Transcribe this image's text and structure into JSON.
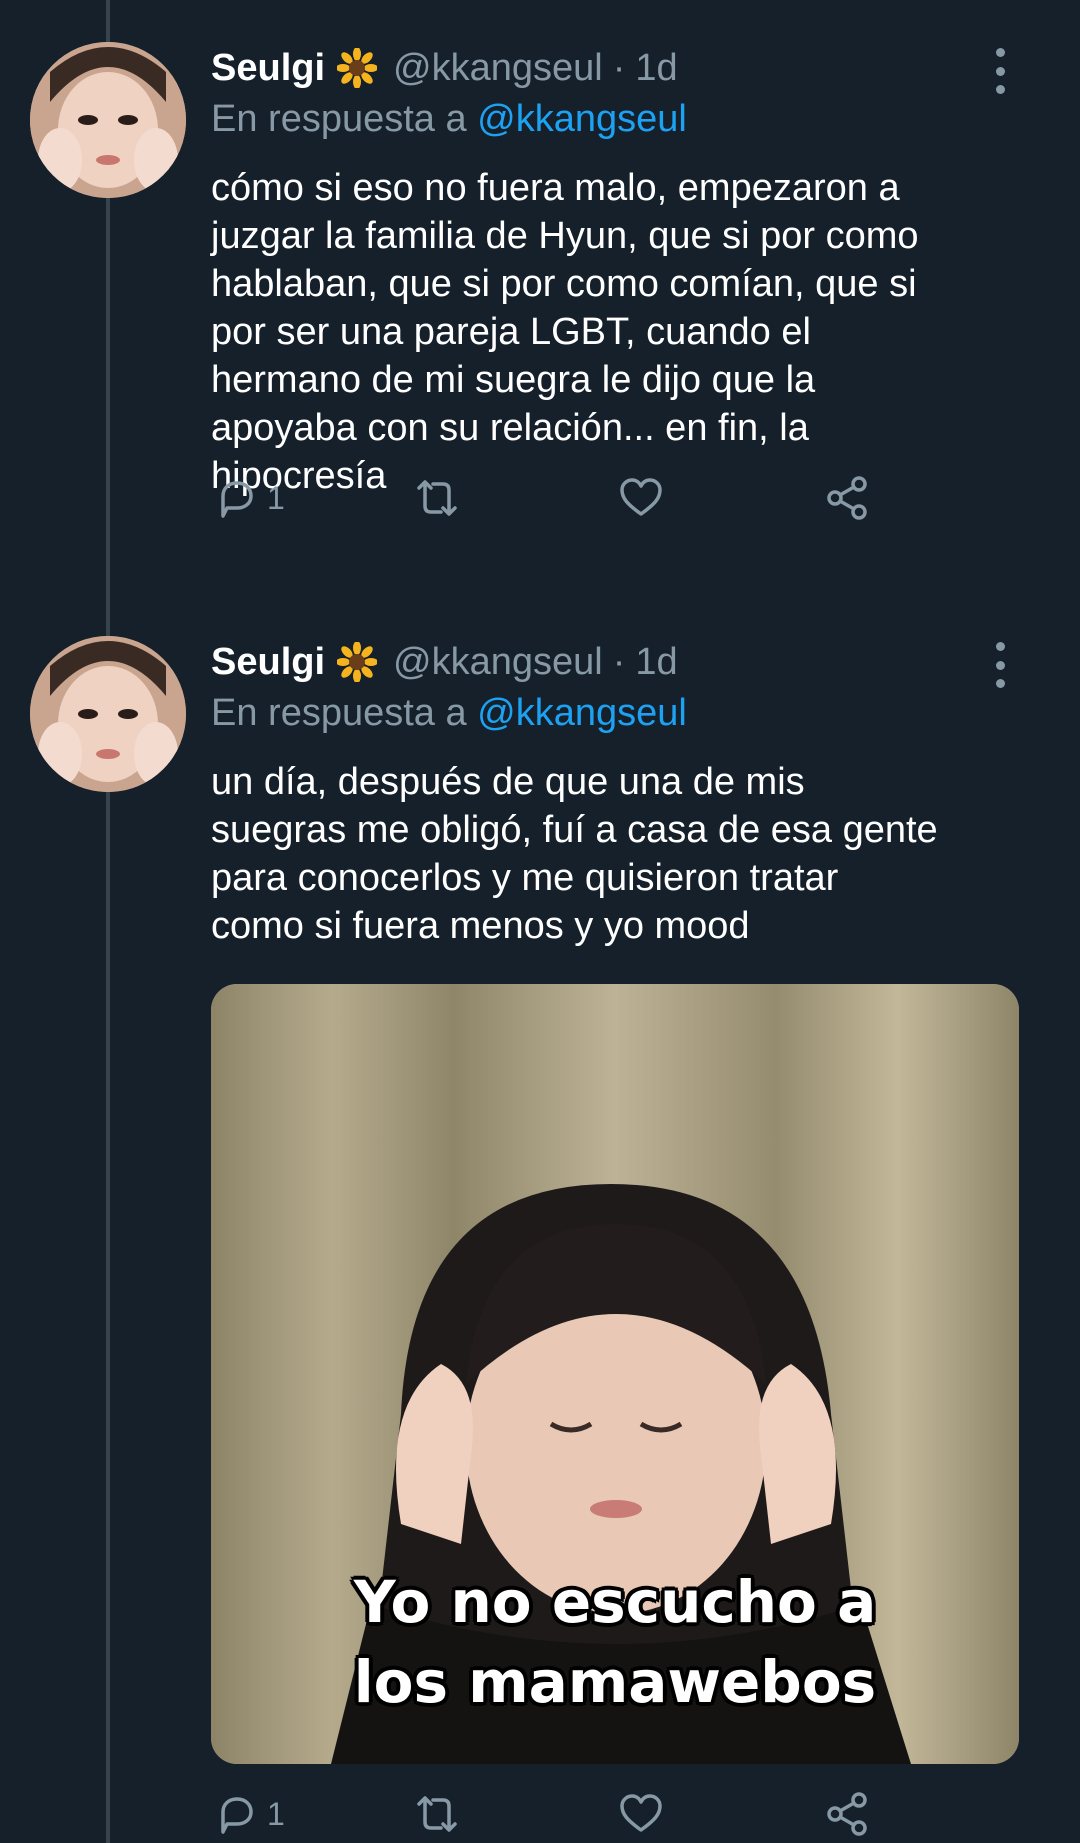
{
  "tweets": [
    {
      "name": "Seulgi",
      "emoji": "sunflower-icon",
      "handle": "@kkangseul",
      "separator": "·",
      "time": "1d",
      "reply_prefix": "En respuesta a",
      "reply_mention": "@kkangseul",
      "text": "cómo si eso no fuera malo, empezaron a\njuzgar la familia de Hyun, que si por como\nhablaban, que si por como comían, que si\npor ser una pareja LGBT, cuando el\nhermano de mi suegra le dijo que la\napoyaba con su relación... en fin, la\nhipocresía",
      "reply_count": "1"
    },
    {
      "name": "Seulgi",
      "emoji": "sunflower-icon",
      "handle": "@kkangseul",
      "separator": "·",
      "time": "1d",
      "reply_prefix": "En respuesta a",
      "reply_mention": "@kkangseul",
      "text": "un día, después de que una de mis\nsuegras me obligó, fuí a casa de esa gente\npara conocerlos y me quisieron tratar\ncomo si fuera menos y yo mood",
      "media_caption": "Yo no escucho a\nlos mamawebos",
      "reply_count": "1"
    }
  ],
  "colors": {
    "background": "#15202b",
    "secondary_text": "#8899a6",
    "link": "#1da1f2",
    "thread_line": "#38444d"
  }
}
